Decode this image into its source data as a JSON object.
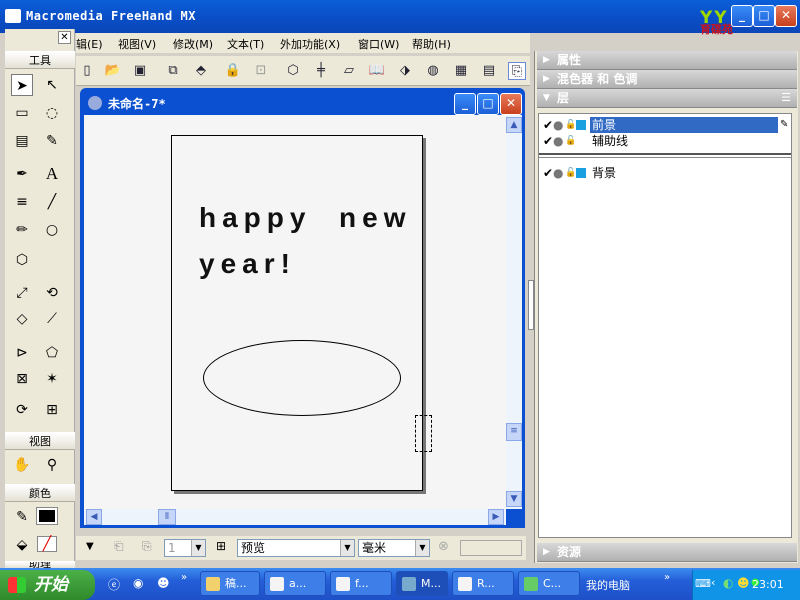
{
  "app": {
    "title": "Macromedia FreeHand MX",
    "brand": "育碟苑",
    "brand_logo": "YY"
  },
  "menu": {
    "items": [
      "辑(E)",
      "视图(V)",
      "修改(M)",
      "文本(T)",
      "外加功能(X)",
      "窗口(W)",
      "帮助(H)"
    ]
  },
  "toolbox": {
    "title": "工具",
    "view_title": "视图",
    "color_title": "颜色",
    "bottom_title": "助理"
  },
  "document": {
    "title": "未命名-7*",
    "canvas_text_line1": "happy  new",
    "canvas_text_line2": "year!"
  },
  "statusbar": {
    "page": "1",
    "view_mode": "预览",
    "units": "毫米"
  },
  "panels": {
    "properties": "属性",
    "mixer": "混色器 和 色调",
    "layers": "层",
    "assets": "资源",
    "layer_items": [
      {
        "name": "前景",
        "selected": true
      },
      {
        "name": "辅助线",
        "selected": false
      },
      {
        "name": "背景",
        "selected": false
      }
    ]
  },
  "taskbar": {
    "start": "开始",
    "tasks": [
      "稿...",
      "a...",
      "f...",
      "M...",
      "R...",
      "C..."
    ],
    "my_computer": "我的电脑",
    "clock": "23:01"
  },
  "colors": {
    "titlebar": "#0a50d0",
    "selection": "#316ac5",
    "layer_swatch": "#19a0e0"
  }
}
